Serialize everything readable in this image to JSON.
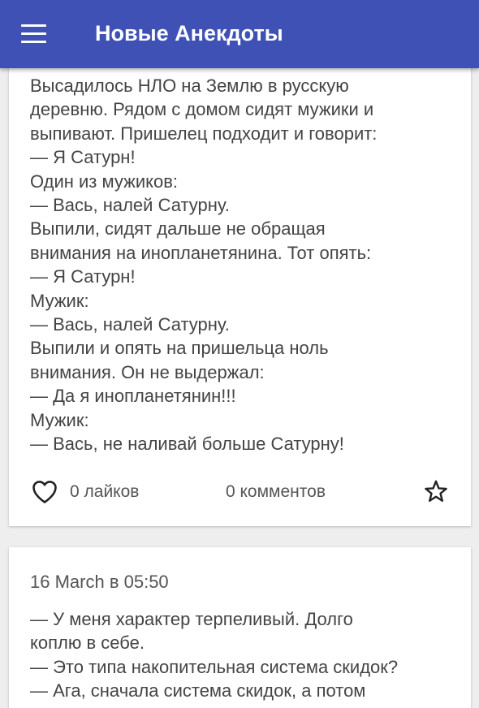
{
  "appbar": {
    "title": "Новые Анекдоты",
    "menu_icon": "hamburger-menu-icon"
  },
  "posts": [
    {
      "text_lines": [
        "Высадилось НЛО на Землю в русскую",
        "деревню. Рядом с домом сидят мужики и",
        "выпивают. Пришелец подходит и говорит:",
        "— Я Сатурн!",
        "Один из мужиков:",
        "— Вась, налей Сатурну.",
        "Выпили, сидят дальше не обращая",
        "внимания на инопланетянина. Тот опять:",
        "— Я Сатурн!",
        "Мужик:",
        "— Вась, налей Сатурну.",
        "Выпили и опять на пришельца ноль",
        "внимания. Он не выдержал:",
        "— Да я инопланетянин!!!",
        "Мужик:",
        "— Вась, не наливай больше Сатурну!"
      ],
      "likes_label": "0 лайков",
      "comments_label": "0 комментов",
      "like_icon": "heart-outline-icon",
      "favorite_icon": "star-outline-icon"
    },
    {
      "date": "16 March в 05:50",
      "text_lines": [
        "— У меня характер терпеливый. Долго",
        "коплю в себе.",
        "— Это типа накопительная система скидок?",
        "— Ага, сначала система скидок, а потом"
      ]
    }
  ],
  "colors": {
    "appbar": "#3f51b5",
    "background": "#eeeeee",
    "card": "#ffffff",
    "text": "#444444"
  }
}
